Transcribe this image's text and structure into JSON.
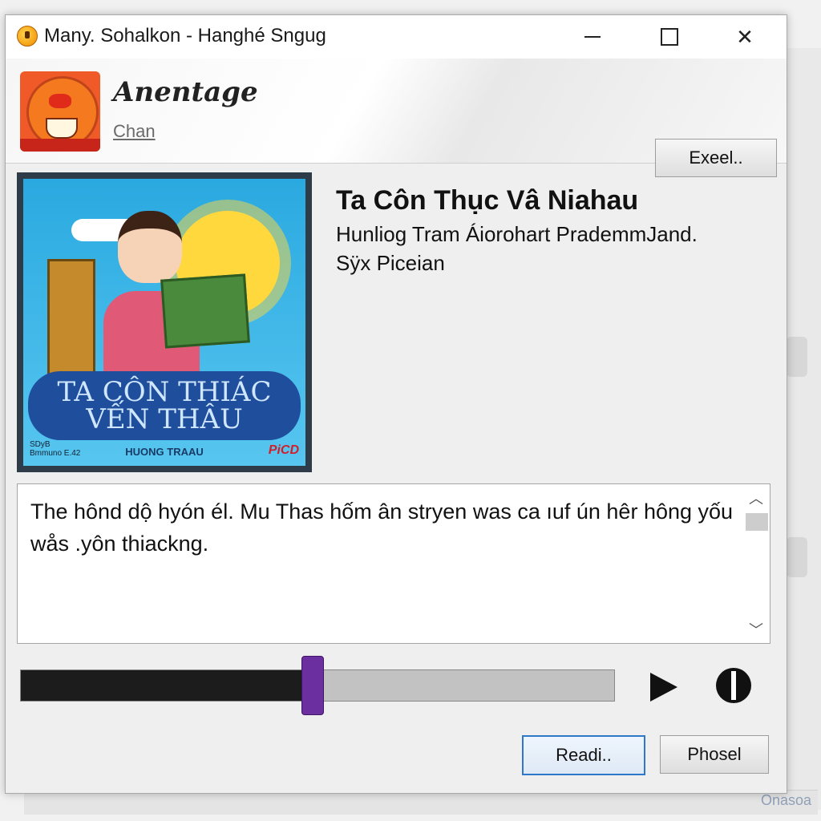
{
  "window": {
    "title": "Many. Sohalkon - Hanghé Sngug"
  },
  "header": {
    "brand": "Anentage",
    "link": "Chan",
    "excel_button": "Exeel.."
  },
  "cover": {
    "title_line1": "TA CÔN THIÁC",
    "title_line2": "VẾN THÂU",
    "author": "HUONG TRAAU",
    "corner_text_1": "SDyB",
    "corner_text_2": "Bmmuno E.42",
    "logo": "PiCD"
  },
  "book": {
    "title": "Ta Côn Thục Vâ Niahau",
    "subtitle": "Hunliog Tram Áiorohart PrademmJand.",
    "meta": "Sÿx Piceian"
  },
  "description": {
    "text": "The hônd dộ hyón él. Mu Thas hốm ân stryen was ca ıuf ún hêr hông yốu wås .yôn thiackng."
  },
  "player": {
    "progress": 0.49
  },
  "buttons": {
    "read": "Readi..",
    "phosel": "Phosel"
  },
  "background": {
    "bottom_text": "Onasoa"
  },
  "colors": {
    "accent_purple": "#6b2fa0",
    "focus_blue": "#2e78c9",
    "progress_fill": "#1c1c1c"
  }
}
